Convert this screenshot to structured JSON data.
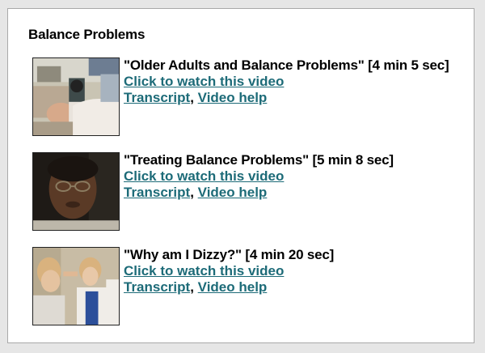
{
  "section": {
    "heading": "Balance Problems"
  },
  "videos": [
    {
      "title": "\"Older Adults and Balance Problems\" [4 min 5 sec]",
      "watch_label": "Click to watch this video",
      "transcript_label": "Transcript",
      "separator": ", ",
      "help_label": "Video help"
    },
    {
      "title": "\"Treating Balance Problems\" [5 min 8 sec]",
      "watch_label": "Click to watch this video",
      "transcript_label": "Transcript",
      "separator": ", ",
      "help_label": "Video help"
    },
    {
      "title": "\"Why am I Dizzy?\" [4 min 20 sec]",
      "watch_label": "Click to watch this video",
      "transcript_label": "Transcript",
      "separator": ", ",
      "help_label": "Video help"
    }
  ],
  "colors": {
    "link": "#1d6b78",
    "text": "#000000",
    "panel_background": "#ffffff",
    "page_background": "#e6e6e6"
  }
}
